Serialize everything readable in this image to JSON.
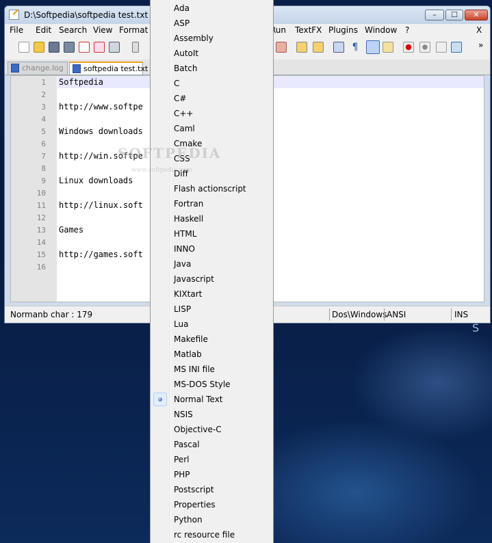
{
  "window": {
    "title": "D:\\Softpedia\\softpedia test.txt - No",
    "controls": {
      "minimize": "–",
      "maximize": "☐",
      "close": "✕"
    }
  },
  "menubar": {
    "items": [
      "File",
      "Edit",
      "Search",
      "View",
      "Format",
      "Run",
      "TextFX",
      "Plugins",
      "Window",
      "?"
    ],
    "close_label": "X"
  },
  "toolbar": {
    "icons": [
      "new-file-icon",
      "open-file-icon",
      "save-icon",
      "save-all-icon",
      "close-icon",
      "close-all-icon",
      "print-icon",
      "cut-icon",
      "zoom-icon",
      "sync-vertical-icon",
      "sync-horizontal-icon",
      "word-wrap-icon",
      "show-all-chars-icon",
      "indent-guide-icon",
      "doc-map-icon",
      "record-macro-icon",
      "stop-macro-icon",
      "play-macro-icon",
      "run-macro-multiple-icon"
    ],
    "overflow": "»"
  },
  "tabs": [
    {
      "label": "change.log",
      "active": false
    },
    {
      "label": "softpedia test.txt",
      "active": true
    }
  ],
  "editor": {
    "line_numbers": [
      "1",
      "2",
      "3",
      "4",
      "5",
      "6",
      "7",
      "8",
      "9",
      "10",
      "11",
      "12",
      "13",
      "14",
      "15",
      "16"
    ],
    "lines": [
      "Softpedia",
      "",
      "http://www.softpe",
      "",
      "Windows downloads",
      "",
      "http://win.softpe",
      "",
      "Linux downloads",
      "",
      "http://linux.soft",
      "",
      "Games",
      "",
      "http://games.soft",
      ""
    ]
  },
  "statusbar": {
    "lang": "Norma",
    "chars": "nb char : 179",
    "eol": "Dos\\Windows",
    "encoding": "ANSI",
    "mode": "INS"
  },
  "language_menu": {
    "items": [
      "Ada",
      "ASP",
      "Assembly",
      "AutoIt",
      "Batch",
      "C",
      "C#",
      "C++",
      "Caml",
      "Cmake",
      "CSS",
      "Diff",
      "Flash actionscript",
      "Fortran",
      "Haskell",
      "HTML",
      "INNO",
      "Java",
      "Javascript",
      "KIXtart",
      "LISP",
      "Lua",
      "Makefile",
      "Matlab",
      "MS INI file",
      "MS-DOS Style",
      "Normal Text",
      "NSIS",
      "Objective-C",
      "Pascal",
      "Perl",
      "PHP",
      "Postscript",
      "Properties",
      "Python",
      "rc resource file"
    ],
    "selected": "Normal Text"
  },
  "watermark": {
    "brand": "SOFTPEDIA",
    "url": "www.softpedia.com"
  },
  "colors": {
    "titlebar": "#c3d4e8",
    "close_button": "#c8432a",
    "active_tab_accent": "#f0a020",
    "current_line": "#e8e8ff",
    "desktop": "#0a1e4a"
  }
}
